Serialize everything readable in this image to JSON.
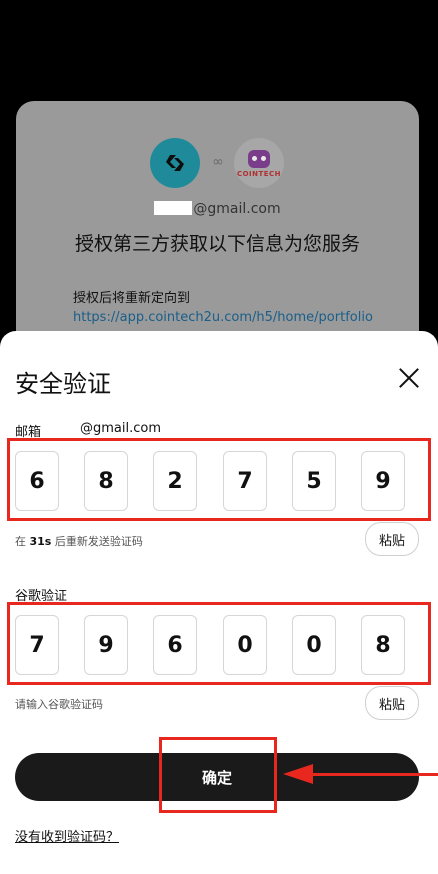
{
  "auth_card": {
    "email_suffix": "@gmail.com",
    "title": "授权第三方获取以下信息为您服务",
    "redirect_label": "授权后将重新定向到",
    "redirect_url": "https://app.cointech2u.com/h5/home/portfolio",
    "partner_logo_text": "COINTECH"
  },
  "modal": {
    "title": "安全验证",
    "email_label": "邮箱",
    "email_value": "@gmail.com",
    "email_code": [
      "6",
      "8",
      "2",
      "7",
      "5",
      "9"
    ],
    "resend_prefix": "在 ",
    "resend_seconds": "31s",
    "resend_suffix": " 后重新发送验证码",
    "paste_label": "粘贴",
    "google_label": "谷歌验证",
    "google_code": [
      "7",
      "9",
      "6",
      "0",
      "0",
      "8"
    ],
    "google_hint": "请输入谷歌验证码",
    "confirm_label": "确定",
    "no_code_link": "没有收到验证码？"
  },
  "colors": {
    "annotation_red": "#e8281f",
    "button_dark": "#1a1a1a",
    "link_blue": "#1a5e8a",
    "brand_teal": "#1f8b9a"
  },
  "icons": {
    "close": "close-icon",
    "link": "link-icon",
    "app_logo": "bitget-logo",
    "partner_logo": "cointech-robot-logo"
  }
}
